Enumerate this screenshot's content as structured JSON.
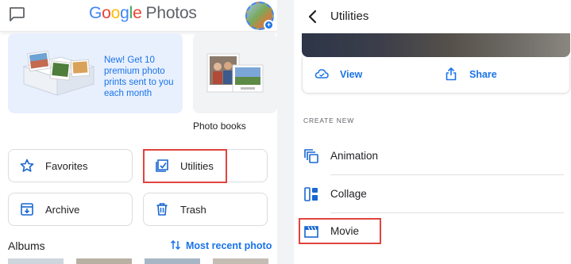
{
  "left_screen": {
    "header": {
      "logo": {
        "google": "Google",
        "photos": "Photos"
      },
      "chat_icon": "chat-bubble-icon",
      "avatar_icon": "account-avatar-icon"
    },
    "promo_card": {
      "text": "New! Get 10 premium photo prints sent to you each month"
    },
    "photobook_card": {
      "label": "Photo books"
    },
    "tiles": {
      "favorites": {
        "label": "Favorites",
        "icon": "star-icon"
      },
      "utilities": {
        "label": "Utilities",
        "icon": "utilities-icon"
      },
      "archive": {
        "label": "Archive",
        "icon": "archive-icon"
      },
      "trash": {
        "label": "Trash",
        "icon": "trash-icon"
      }
    },
    "albums": {
      "label": "Albums",
      "sort_label": "Most recent photo",
      "sort_icon": "sort-icon"
    }
  },
  "right_screen": {
    "header": {
      "title": "Utilities",
      "back_icon": "back-arrow-icon"
    },
    "actions": {
      "view": {
        "label": "View",
        "icon": "cloud-icon"
      },
      "share": {
        "label": "Share",
        "icon": "share-icon"
      }
    },
    "create_new": {
      "section_label": "CREATE NEW",
      "items": [
        {
          "label": "Animation",
          "icon": "animation-icon"
        },
        {
          "label": "Collage",
          "icon": "collage-icon"
        },
        {
          "label": "Movie",
          "icon": "movie-icon"
        }
      ]
    }
  },
  "colors": {
    "accent": "#1a73e8",
    "highlight": "#e0443e",
    "promo_bg": "#e8f0fe",
    "divider_bg": "#f1f3f4",
    "icon_blue": "#1967d2"
  }
}
